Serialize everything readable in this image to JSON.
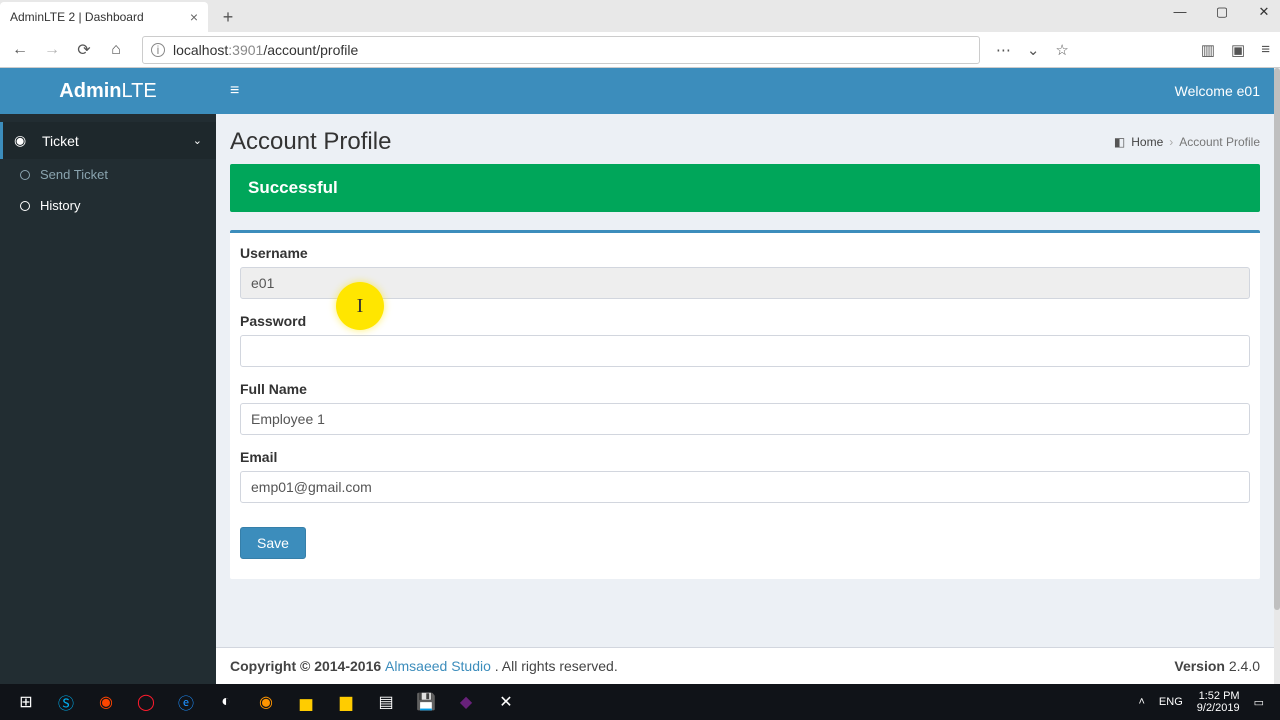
{
  "browser": {
    "tab_title": "AdminLTE 2 | Dashboard",
    "url_host": "localhost",
    "url_port": ":3901",
    "url_path": "/account/profile"
  },
  "logo": {
    "bold": "Admin",
    "light": "LTE"
  },
  "topbar": {
    "welcome": "Welcome e01"
  },
  "sidebar": {
    "ticket_label": "Ticket",
    "send_label": "Send Ticket",
    "history_label": "History"
  },
  "page": {
    "title": "Account Profile",
    "crumb_home": "Home",
    "crumb_current": "Account Profile",
    "alert": "Successful"
  },
  "form": {
    "username_label": "Username",
    "username_value": "e01",
    "password_label": "Password",
    "password_value": "",
    "fullname_label": "Full Name",
    "fullname_value": "Employee 1",
    "email_label": "Email",
    "email_value": "emp01@gmail.com",
    "save_label": "Save"
  },
  "footer": {
    "copyright": "Copyright © 2014-2016 ",
    "studio": "Almsaeed Studio",
    "rights": ". All rights reserved.",
    "version_label": "Version",
    "version": " 2.4.0"
  },
  "system": {
    "lang": "ENG",
    "time": "1:52 PM",
    "date": "9/2/2019"
  }
}
